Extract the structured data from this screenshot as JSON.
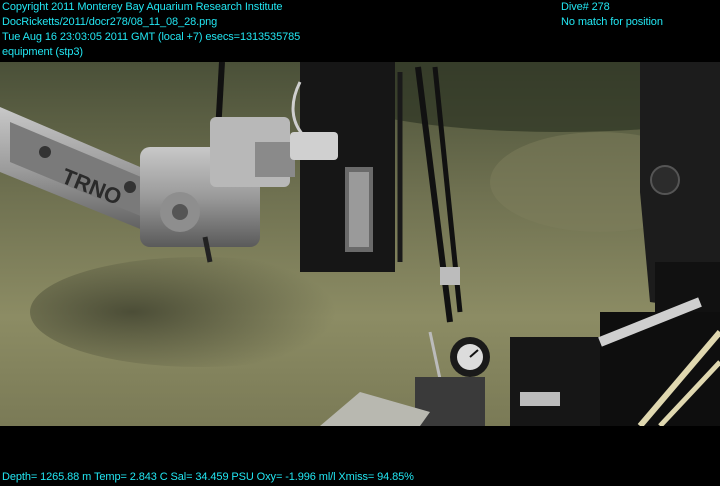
{
  "overlay": {
    "top_left": [
      "Copyright 2011 Monterey Bay Aquarium Research Institute",
      "DocRicketts/2011/docr278/08_11_08_28.png",
      "Tue Aug 16 23:03:05 2011 GMT (local +7)  esecs=1313535785",
      "equipment (stp3)"
    ],
    "top_right": [
      "Dive# 278",
      "No match for position"
    ],
    "bottom": "Depth= 1265.88 m  Temp= 2.843 C  Sal= 34.459 PSU  Oxy= -1.996 ml/l  Xmiss= 94.85%"
  },
  "colors": {
    "overlay_text": "#22e6f2",
    "letterbox": "#000000",
    "seafloor": "#8a8a60"
  },
  "scene": {
    "description_icons": [
      "robotic-arm-icon",
      "sampler-frame-icon",
      "gauge-icon",
      "vehicle-hull-icon"
    ],
    "arm_label": "TRNO"
  }
}
